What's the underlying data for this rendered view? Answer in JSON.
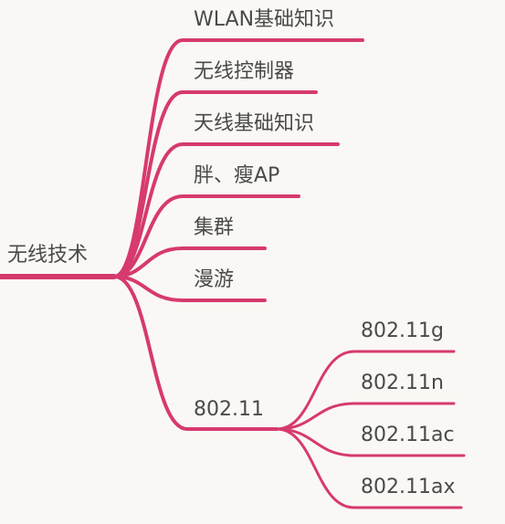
{
  "style": {
    "branch_color": "#d63a6e",
    "text_color": "#4a4a4a",
    "background": "#faf8f4"
  },
  "root": {
    "label": "无线技术"
  },
  "children": [
    {
      "label": "WLAN基础知识"
    },
    {
      "label": "无线控制器"
    },
    {
      "label": "天线基础知识"
    },
    {
      "label": "胖、瘦AP"
    },
    {
      "label": "集群"
    },
    {
      "label": "漫游"
    },
    {
      "label": "802.11",
      "children": [
        {
          "label": "802.11g"
        },
        {
          "label": "802.11n"
        },
        {
          "label": "802.11ac"
        },
        {
          "label": "802.11ax"
        }
      ]
    }
  ]
}
